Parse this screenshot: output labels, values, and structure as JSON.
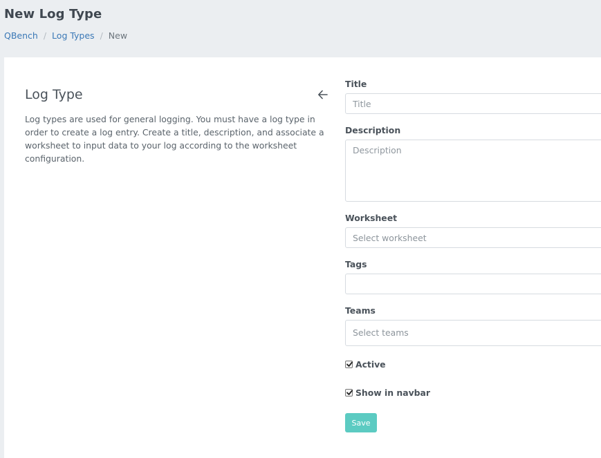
{
  "header": {
    "title": "New Log Type",
    "breadcrumb": [
      "QBench",
      "Log Types",
      "New"
    ]
  },
  "intro": {
    "title": "Log Type",
    "description": "Log types are used for general logging. You must have a log type in order to create a log entry. Create a title, description, and associate a worksheet to input data to your log according to the worksheet configuration.",
    "back_icon": "arrow-left-icon"
  },
  "form": {
    "title": {
      "label": "Title",
      "placeholder": "Title",
      "value": ""
    },
    "description": {
      "label": "Description",
      "placeholder": "Description",
      "value": ""
    },
    "worksheet": {
      "label": "Worksheet",
      "placeholder": "Select worksheet"
    },
    "tags": {
      "label": "Tags",
      "value": ""
    },
    "teams": {
      "label": "Teams",
      "placeholder": "Select teams"
    },
    "active": {
      "label": "Active",
      "checked": true
    },
    "show_in_navbar": {
      "label": "Show in navbar",
      "checked": true
    },
    "save_label": "Save"
  },
  "colors": {
    "accent": "#5ccbc2",
    "link": "#3a78b6",
    "background": "#ebeef1"
  }
}
